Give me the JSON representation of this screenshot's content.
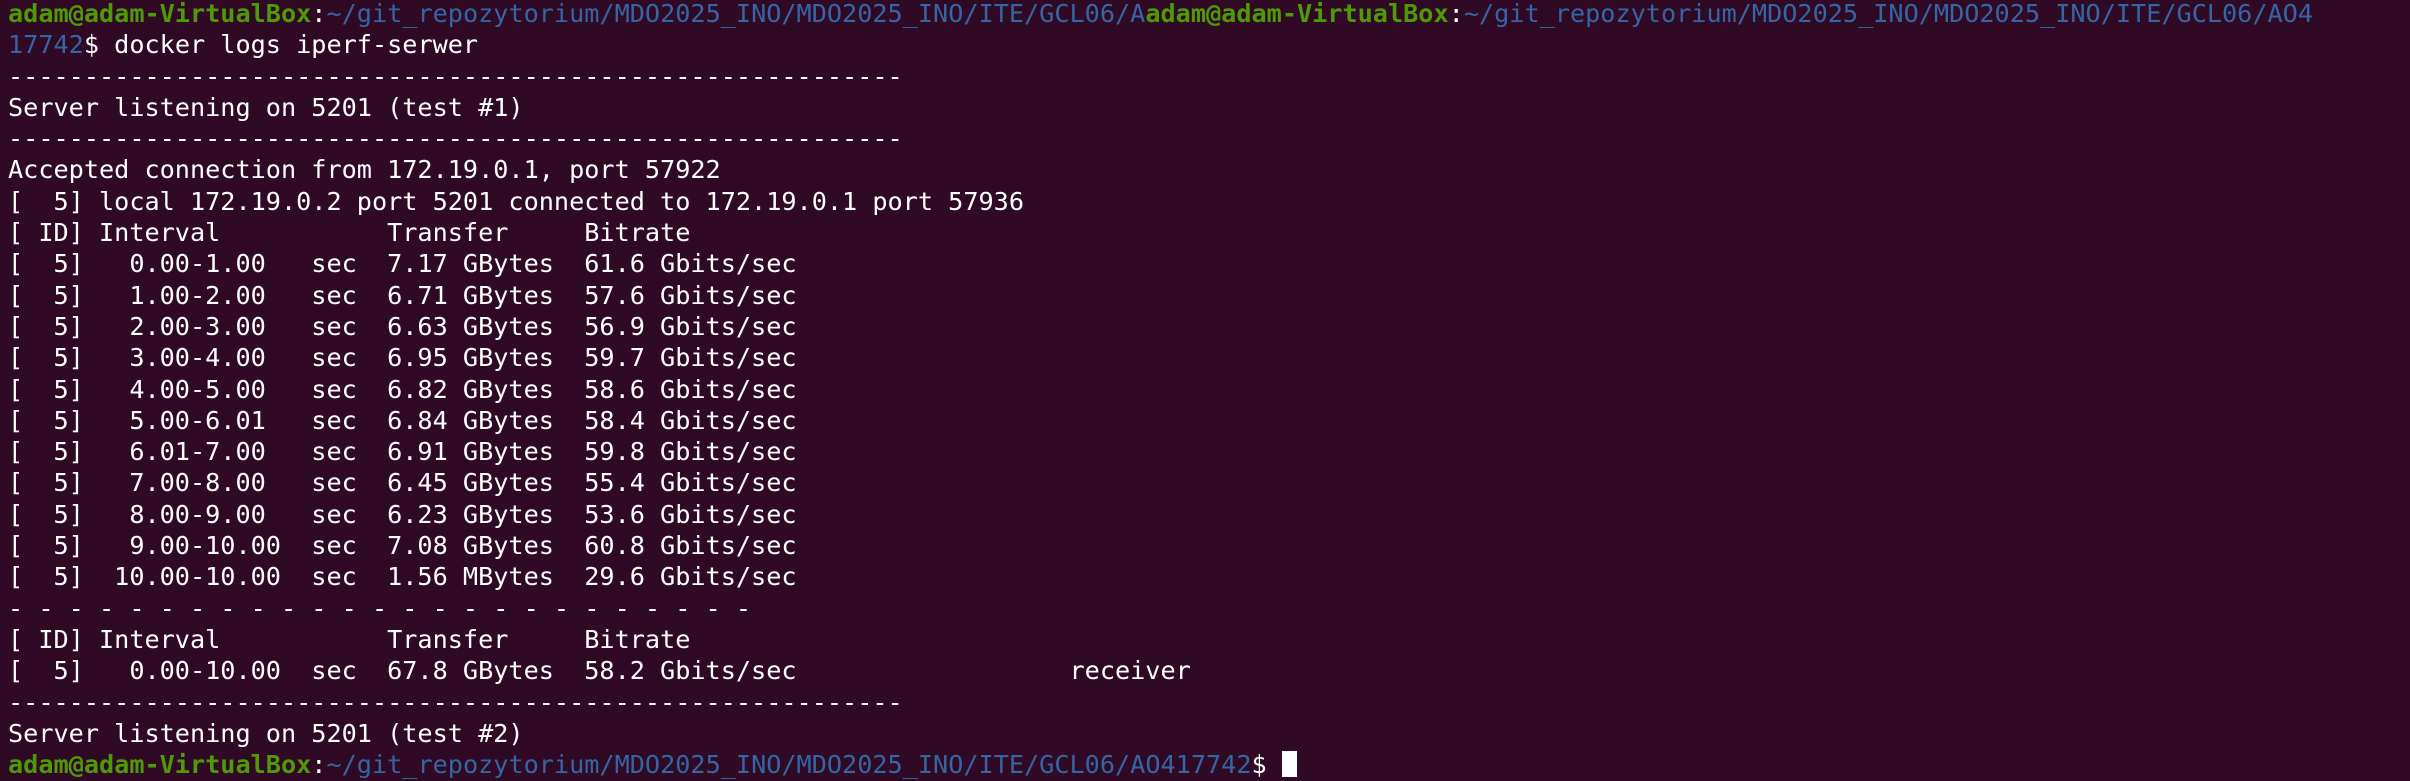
{
  "terminal": {
    "prompt_user": "adam@adam-VirtualBox",
    "prompt_separator": ":",
    "line1_path_a": "~/git_repozytorium/MDO2025_INO/MDO2025_INO/ITE/GCL06/A",
    "line1_user_b": "adam@adam-VirtualBox",
    "line1_path_b": "~/git_repozytorium/MDO2025_INO/MDO2025_INO/ITE/GCL06/AO4",
    "line2_path_cont": "17742",
    "line2_rest": "$ docker logs iperf-serwer",
    "output": [
      "-----------------------------------------------------------",
      "Server listening on 5201 (test #1)",
      "-----------------------------------------------------------",
      "Accepted connection from 172.19.0.1, port 57922",
      "[  5] local 172.19.0.2 port 5201 connected to 172.19.0.1 port 57936",
      "[ ID] Interval           Transfer     Bitrate",
      "[  5]   0.00-1.00   sec  7.17 GBytes  61.6 Gbits/sec",
      "[  5]   1.00-2.00   sec  6.71 GBytes  57.6 Gbits/sec",
      "[  5]   2.00-3.00   sec  6.63 GBytes  56.9 Gbits/sec",
      "[  5]   3.00-4.00   sec  6.95 GBytes  59.7 Gbits/sec",
      "[  5]   4.00-5.00   sec  6.82 GBytes  58.6 Gbits/sec",
      "[  5]   5.00-6.01   sec  6.84 GBytes  58.4 Gbits/sec",
      "[  5]   6.01-7.00   sec  6.91 GBytes  59.8 Gbits/sec",
      "[  5]   7.00-8.00   sec  6.45 GBytes  55.4 Gbits/sec",
      "[  5]   8.00-9.00   sec  6.23 GBytes  53.6 Gbits/sec",
      "[  5]   9.00-10.00  sec  7.08 GBytes  60.8 Gbits/sec",
      "[  5]  10.00-10.00  sec  1.56 MBytes  29.6 Gbits/sec",
      "- - - - - - - - - - - - - - - - - - - - - - - - -",
      "[ ID] Interval           Transfer     Bitrate",
      "[  5]   0.00-10.00  sec  67.8 GBytes  58.2 Gbits/sec                  receiver",
      "-----------------------------------------------------------",
      "Server listening on 5201 (test #2)"
    ],
    "final_prompt_path": "~/git_repozytorium/MDO2025_INO/MDO2025_INO/ITE/GCL06/AO417742",
    "final_prompt_symbol": "$ ",
    "colors": {
      "background": "#300a24",
      "text": "#ffffff",
      "user": "#4e9a06",
      "path": "#3465a4"
    }
  }
}
